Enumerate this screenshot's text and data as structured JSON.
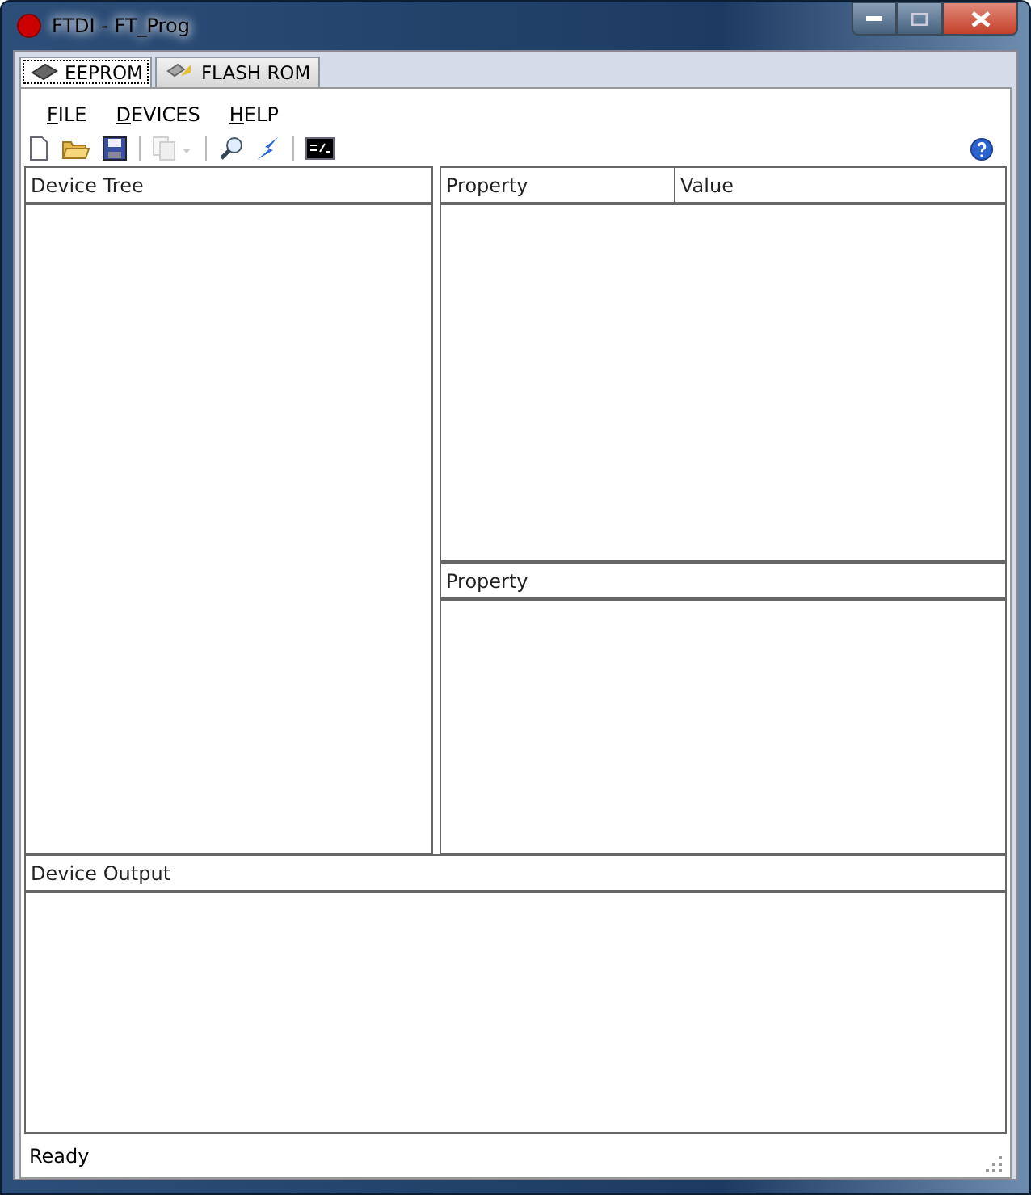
{
  "window": {
    "title": "FTDI - FT_Prog"
  },
  "tabs": [
    {
      "label": "EEPROM",
      "selected": true
    },
    {
      "label": "FLASH ROM",
      "selected": false
    }
  ],
  "menu": [
    "FILE",
    "DEVICES",
    "HELP"
  ],
  "toolbar": [
    {
      "disabled": false
    },
    {
      "disabled": false
    },
    {
      "disabled": false
    },
    {
      "disabled": true
    },
    {
      "disabled": false
    },
    {
      "disabled": false
    },
    {
      "disabled": false
    }
  ],
  "device_tree": {
    "header": "Device Tree"
  },
  "property_grid": {
    "columns": [
      "Property",
      "Value"
    ]
  },
  "property_detail": {
    "header": "Property"
  },
  "device_output": {
    "header": "Device Output"
  },
  "status_bar": {
    "text": "Ready"
  }
}
